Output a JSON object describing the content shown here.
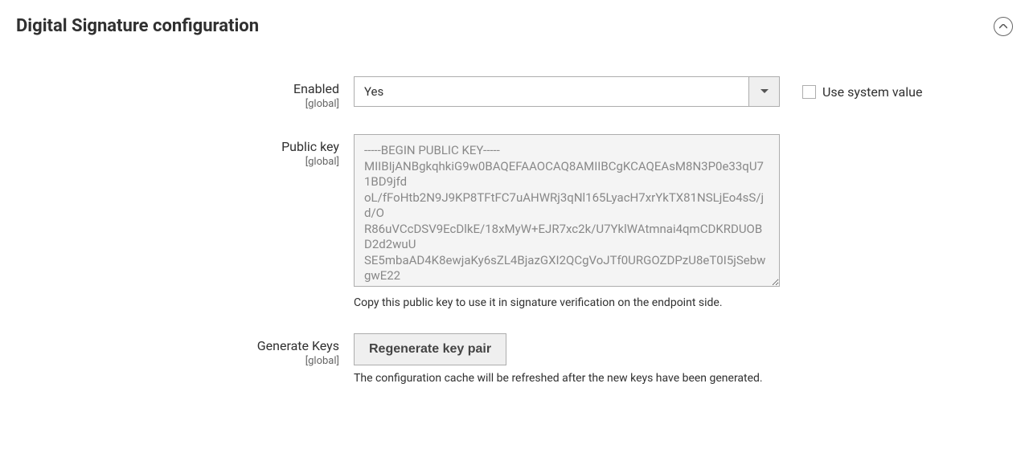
{
  "section": {
    "title": "Digital Signature configuration"
  },
  "fields": {
    "enabled": {
      "label": "Enabled",
      "scope": "[global]",
      "value": "Yes",
      "use_system_label": "Use system value"
    },
    "public_key": {
      "label": "Public key",
      "scope": "[global]",
      "value": "-----BEGIN PUBLIC KEY-----\nMIIBIjANBgkqhkiG9w0BAQEFAAOCAQ8AMIIBCgKCAQEAsM8N3P0e33qU71BD9jfd\noL/fFoHtb2N9J9KP8TFtFC7uAHWRj3qNl165LyacH7xrYkTX81NSLjEo4sS/jd/O\nR86uVCcDSV9EcDlkE/18xMyW+EJR7xc2k/U7YklWAtmnai4qmCDKRDUOBD2d2wuU\nSE5mbaAD4K8ewjaKy6sZL4BjazGXI2QCgVoJTf0URGOZDPzU8eT0I5jSebwgwE22",
      "help": "Copy this public key to use it in signature verification on the endpoint side."
    },
    "generate_keys": {
      "label": "Generate Keys",
      "scope": "[global]",
      "button": "Regenerate key pair",
      "help": "The configuration cache will be refreshed after the new keys have been generated."
    }
  }
}
